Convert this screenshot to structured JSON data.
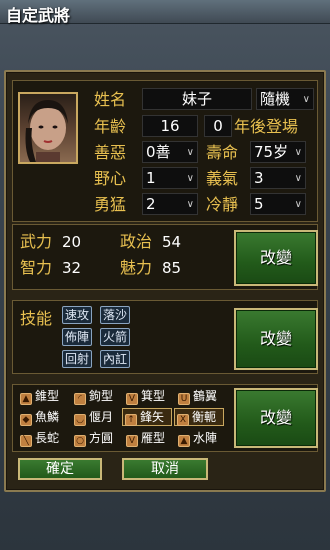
{
  "window": {
    "title": "自定武將"
  },
  "profile": {
    "name_label": "姓名",
    "name_value": "妹子",
    "random_select": "隨機",
    "age_label": "年齡",
    "age_value": "16",
    "appear_years_value": "0",
    "appear_label": "年後登場",
    "good_evil_label": "善惡",
    "good_evil_value": "0善",
    "lifespan_label": "壽命",
    "lifespan_value": "75岁",
    "ambition_label": "野心",
    "ambition_value": "1",
    "loyalty_label": "義氣",
    "loyalty_value": "3",
    "bravery_label": "勇猛",
    "bravery_value": "2",
    "calm_label": "冷靜",
    "calm_value": "5"
  },
  "stats": {
    "war_label": "武力",
    "war_value": "20",
    "politics_label": "政治",
    "politics_value": "54",
    "intellect_label": "智力",
    "intellect_value": "32",
    "charm_label": "魅力",
    "charm_value": "85",
    "change_label": "改變"
  },
  "skills": {
    "label": "技能",
    "items": [
      "速攻",
      "落沙",
      "佈陣",
      "火箭",
      "回射",
      "內訌"
    ],
    "change_label": "改變"
  },
  "formations": {
    "items": [
      {
        "label": "錐型",
        "selected": false
      },
      {
        "label": "鉤型",
        "selected": false
      },
      {
        "label": "箕型",
        "selected": false
      },
      {
        "label": "鶴翼",
        "selected": false
      },
      {
        "label": "魚鱗",
        "selected": false
      },
      {
        "label": "偃月",
        "selected": false
      },
      {
        "label": "鋒矢",
        "selected": true
      },
      {
        "label": "衡軛",
        "selected": true
      },
      {
        "label": "長蛇",
        "selected": false
      },
      {
        "label": "方圓",
        "selected": false
      },
      {
        "label": "雁型",
        "selected": false
      },
      {
        "label": "水陣",
        "selected": false
      }
    ],
    "change_label": "改變"
  },
  "actions": {
    "confirm": "確定",
    "cancel": "取消"
  },
  "colors": {
    "label_gold": "#e8c050",
    "button_green": "#2a6a22",
    "frame_gold": "#c9b878"
  }
}
